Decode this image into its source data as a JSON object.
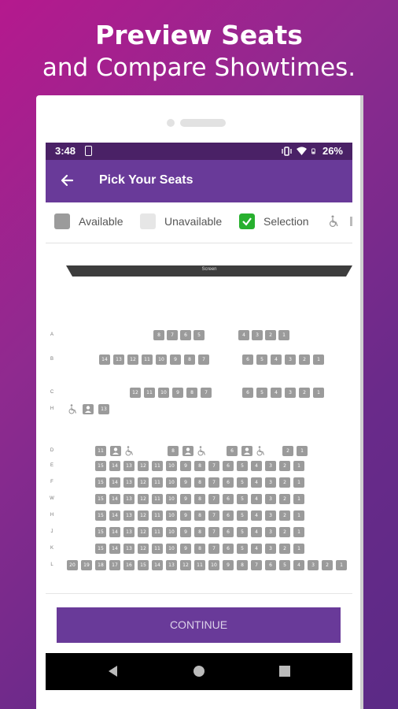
{
  "headline": {
    "line1": "Preview Seats",
    "line2": "and Compare Showtimes."
  },
  "statusbar": {
    "time": "3:48",
    "battery": "26%"
  },
  "appbar": {
    "title": "Pick Your Seats",
    "back_icon": "arrow-left-icon"
  },
  "legend": {
    "available": "Available",
    "unavailable": "Unavailable",
    "selection": "Selection",
    "wheelchair_icon": "wheelchair-icon"
  },
  "screen_label": "Screen",
  "colors": {
    "purple": "#693a99",
    "status": "#4a2166",
    "seat": "#9b9b9b",
    "selection": "#27b02e"
  },
  "seat_rows": [
    {
      "label": "A",
      "seats": [
        "8",
        "7",
        "6",
        "5",
        "4",
        "3",
        "2",
        "1"
      ]
    },
    {
      "label": "B",
      "seats": [
        "14",
        "13",
        "12",
        "11",
        "10",
        "9",
        "8",
        "7",
        "6",
        "5",
        "4",
        "3",
        "2",
        "1"
      ]
    },
    {
      "label": "C",
      "seats": [
        "12",
        "11",
        "10",
        "9",
        "8",
        "7",
        "6",
        "5",
        "4",
        "3",
        "2",
        "1"
      ]
    },
    {
      "label": "H",
      "seats": [
        "wheelchair",
        "companion",
        "13"
      ]
    },
    {
      "label": "D",
      "seats": [
        "11",
        "companion",
        "wheelchair",
        "8",
        "companion",
        "wheelchair",
        "6",
        "companion",
        "wheelchair",
        "2",
        "1"
      ]
    },
    {
      "label": "E",
      "seats": [
        "15",
        "14",
        "13",
        "12",
        "11",
        "10",
        "9",
        "8",
        "7",
        "6",
        "5",
        "4",
        "3",
        "2",
        "1"
      ]
    },
    {
      "label": "F",
      "seats": [
        "15",
        "14",
        "13",
        "12",
        "11",
        "10",
        "9",
        "8",
        "7",
        "6",
        "5",
        "4",
        "3",
        "2",
        "1"
      ]
    },
    {
      "label": "W",
      "seats": [
        "15",
        "14",
        "13",
        "12",
        "11",
        "10",
        "9",
        "8",
        "7",
        "6",
        "5",
        "4",
        "3",
        "2",
        "1"
      ]
    },
    {
      "label": "H",
      "seats": [
        "15",
        "14",
        "13",
        "12",
        "11",
        "10",
        "9",
        "8",
        "7",
        "6",
        "5",
        "4",
        "3",
        "2",
        "1"
      ]
    },
    {
      "label": "J",
      "seats": [
        "15",
        "14",
        "13",
        "12",
        "11",
        "10",
        "9",
        "8",
        "7",
        "6",
        "5",
        "4",
        "3",
        "2",
        "1"
      ]
    },
    {
      "label": "K",
      "seats": [
        "15",
        "14",
        "13",
        "12",
        "11",
        "10",
        "9",
        "8",
        "7",
        "6",
        "5",
        "4",
        "3",
        "2",
        "1"
      ]
    },
    {
      "label": "L",
      "seats": [
        "20",
        "19",
        "18",
        "17",
        "16",
        "15",
        "14",
        "13",
        "12",
        "11",
        "10",
        "9",
        "8",
        "7",
        "6",
        "5",
        "4",
        "3",
        "2",
        "1"
      ]
    }
  ],
  "continue_label": "CONTINUE",
  "nav": {
    "back": "nav-back-icon",
    "home": "nav-home-icon",
    "recents": "nav-recents-icon"
  }
}
